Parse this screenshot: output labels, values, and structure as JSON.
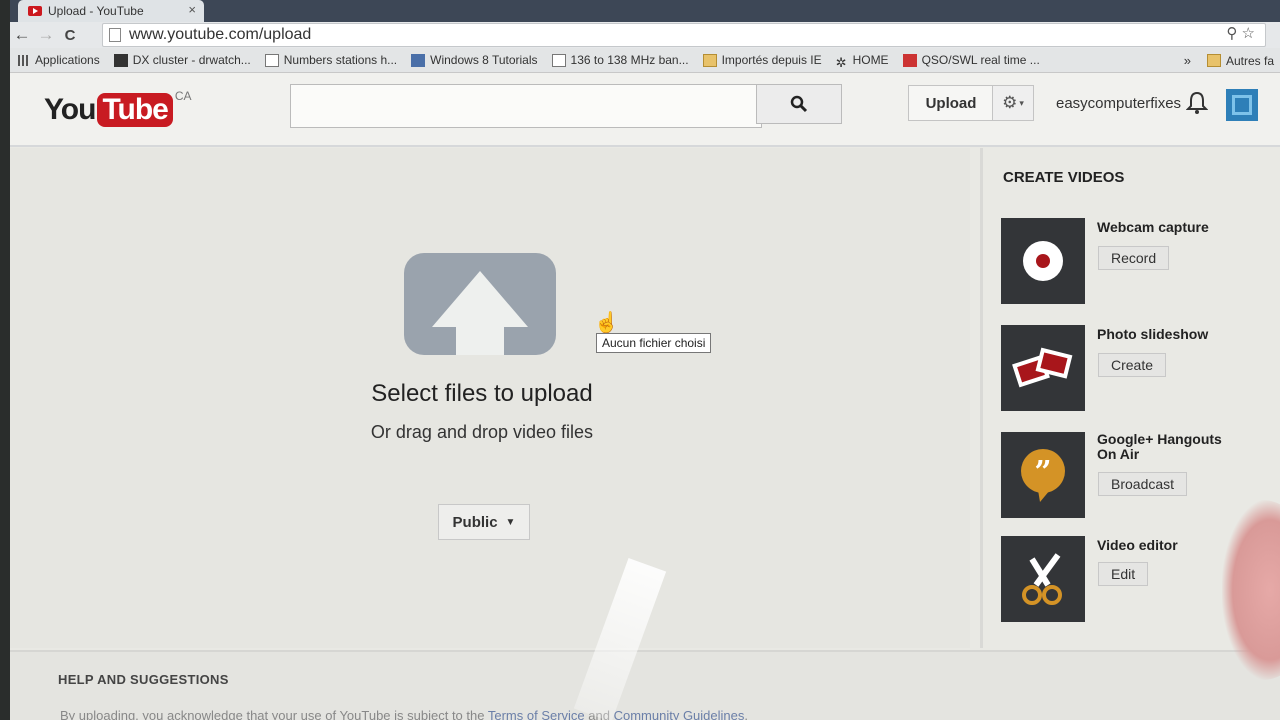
{
  "browser": {
    "tab_title": "Upload - YouTube",
    "tab_close": "×",
    "url": "www.youtube.com/upload",
    "nav": {
      "back": "←",
      "forward": "→",
      "reload": "C"
    },
    "omni_icons": "⚲ ☆",
    "bookmarks": [
      {
        "label": "Applications",
        "icon": "apps-icon"
      },
      {
        "label": "DX cluster - drwatch...",
        "icon": "dx-icon"
      },
      {
        "label": "Numbers stations h...",
        "icon": "page-icon"
      },
      {
        "label": "Windows 8 Tutorials",
        "icon": "windows-icon"
      },
      {
        "label": "136 to 138 MHz ban...",
        "icon": "page-icon"
      },
      {
        "label": "Importés depuis IE",
        "icon": "folder-icon"
      },
      {
        "label": "HOME",
        "icon": "snowflake-icon"
      },
      {
        "label": "QSO/SWL real time ...",
        "icon": "qso-icon"
      }
    ],
    "bookmarks_overflow": "»",
    "bookmarks_other": "Autres fa"
  },
  "masthead": {
    "logo_you": "You",
    "logo_tube": "Tube",
    "logo_country": "CA",
    "search_placeholder": "",
    "upload_label": "Upload",
    "username": "easycomputerfixes"
  },
  "upload": {
    "select_text": "Select files to upload",
    "drag_text": "Or drag and drop video files",
    "privacy_label": "Public",
    "tooltip": "Aucun fichier choisi"
  },
  "create_videos": {
    "title": "CREATE VIDEOS",
    "items": [
      {
        "title": "Webcam capture",
        "button": "Record",
        "icon": "webcam-icon"
      },
      {
        "title": "Photo slideshow",
        "button": "Create",
        "icon": "photos-icon"
      },
      {
        "title": "Google+ Hangouts On Air",
        "button": "Broadcast",
        "icon": "hangouts-icon"
      },
      {
        "title": "Video editor",
        "button": "Edit",
        "icon": "scissors-icon"
      }
    ]
  },
  "help": {
    "title": "HELP AND SUGGESTIONS",
    "text_before": "By uploading, you acknowledge that your use of YouTube is subject to the ",
    "terms_link": "Terms of Service",
    "text_and": " and ",
    "guidelines_link": "Community Guidelines",
    "text_after": "."
  }
}
